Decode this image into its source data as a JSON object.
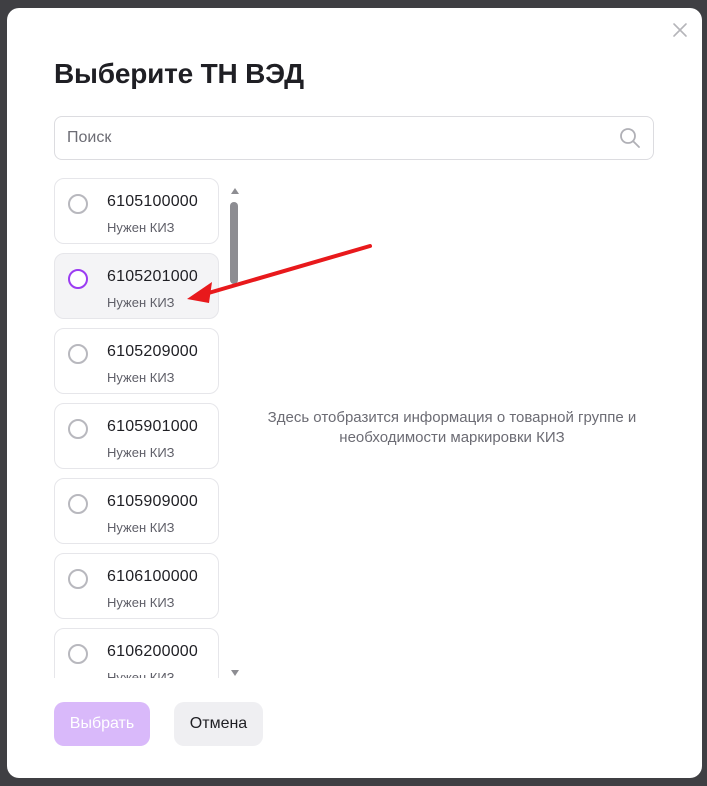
{
  "modal": {
    "title": "Выберите ТН ВЭД",
    "search": {
      "placeholder": "Поиск",
      "value": ""
    },
    "items": [
      {
        "code": "6105100000",
        "note": "Нужен КИЗ",
        "selected": false
      },
      {
        "code": "6105201000",
        "note": "Нужен КИЗ",
        "selected": true
      },
      {
        "code": "6105209000",
        "note": "Нужен КИЗ",
        "selected": false
      },
      {
        "code": "6105901000",
        "note": "Нужен КИЗ",
        "selected": false
      },
      {
        "code": "6105909000",
        "note": "Нужен КИЗ",
        "selected": false
      },
      {
        "code": "6106100000",
        "note": "Нужен КИЗ",
        "selected": false
      },
      {
        "code": "6106200000",
        "note": "Нужен КИЗ",
        "selected": false
      }
    ],
    "info_text": "Здесь отобразится информация о товарной группе и необходимости маркировки КИЗ",
    "buttons": {
      "select": "Выбрать",
      "cancel": "Отмена"
    }
  },
  "colors": {
    "accent": "#9b3cf2",
    "primary_disabled": "#d9b9fa",
    "annotation_arrow": "#e8191c"
  }
}
